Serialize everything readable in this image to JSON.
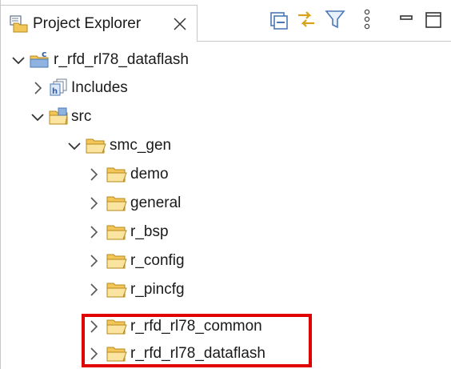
{
  "view": {
    "tab_label": "Project Explorer",
    "tab_icon": "project-explorer-icon",
    "toolbar": [
      {
        "name": "collapse-all-button",
        "icon": "collapse-all-icon"
      },
      {
        "name": "link-with-editor-button",
        "icon": "link-with-editor-icon"
      },
      {
        "name": "filter-button",
        "icon": "filter-icon"
      },
      {
        "name": "view-menu-button",
        "icon": "vertical-ellipsis-icon"
      },
      {
        "name": "minimize-button",
        "icon": "minimize-icon"
      },
      {
        "name": "maximize-button",
        "icon": "maximize-icon"
      }
    ]
  },
  "tree": {
    "project": {
      "label": "r_rfd_rl78_dataflash",
      "icon": "c-project-icon",
      "expanded": true
    },
    "includes": {
      "label": "Includes",
      "icon": "includes-icon",
      "expanded": false
    },
    "src": {
      "label": "src",
      "icon": "source-folder-icon",
      "expanded": true
    },
    "smc_gen": {
      "label": "smc_gen",
      "icon": "folder-icon",
      "expanded": true
    },
    "children": [
      {
        "label": "demo",
        "icon": "folder-icon",
        "expanded": false
      },
      {
        "label": "general",
        "icon": "folder-icon",
        "expanded": false
      },
      {
        "label": "r_bsp",
        "icon": "folder-icon",
        "expanded": false
      },
      {
        "label": "r_config",
        "icon": "folder-icon",
        "expanded": false
      },
      {
        "label": "r_pincfg",
        "icon": "folder-icon",
        "expanded": false
      },
      {
        "label": "r_rfd_rl78_common",
        "icon": "folder-icon",
        "expanded": false
      },
      {
        "label": "r_rfd_rl78_dataflash",
        "icon": "folder-icon",
        "expanded": false
      }
    ]
  },
  "highlight_color": "#e00000"
}
